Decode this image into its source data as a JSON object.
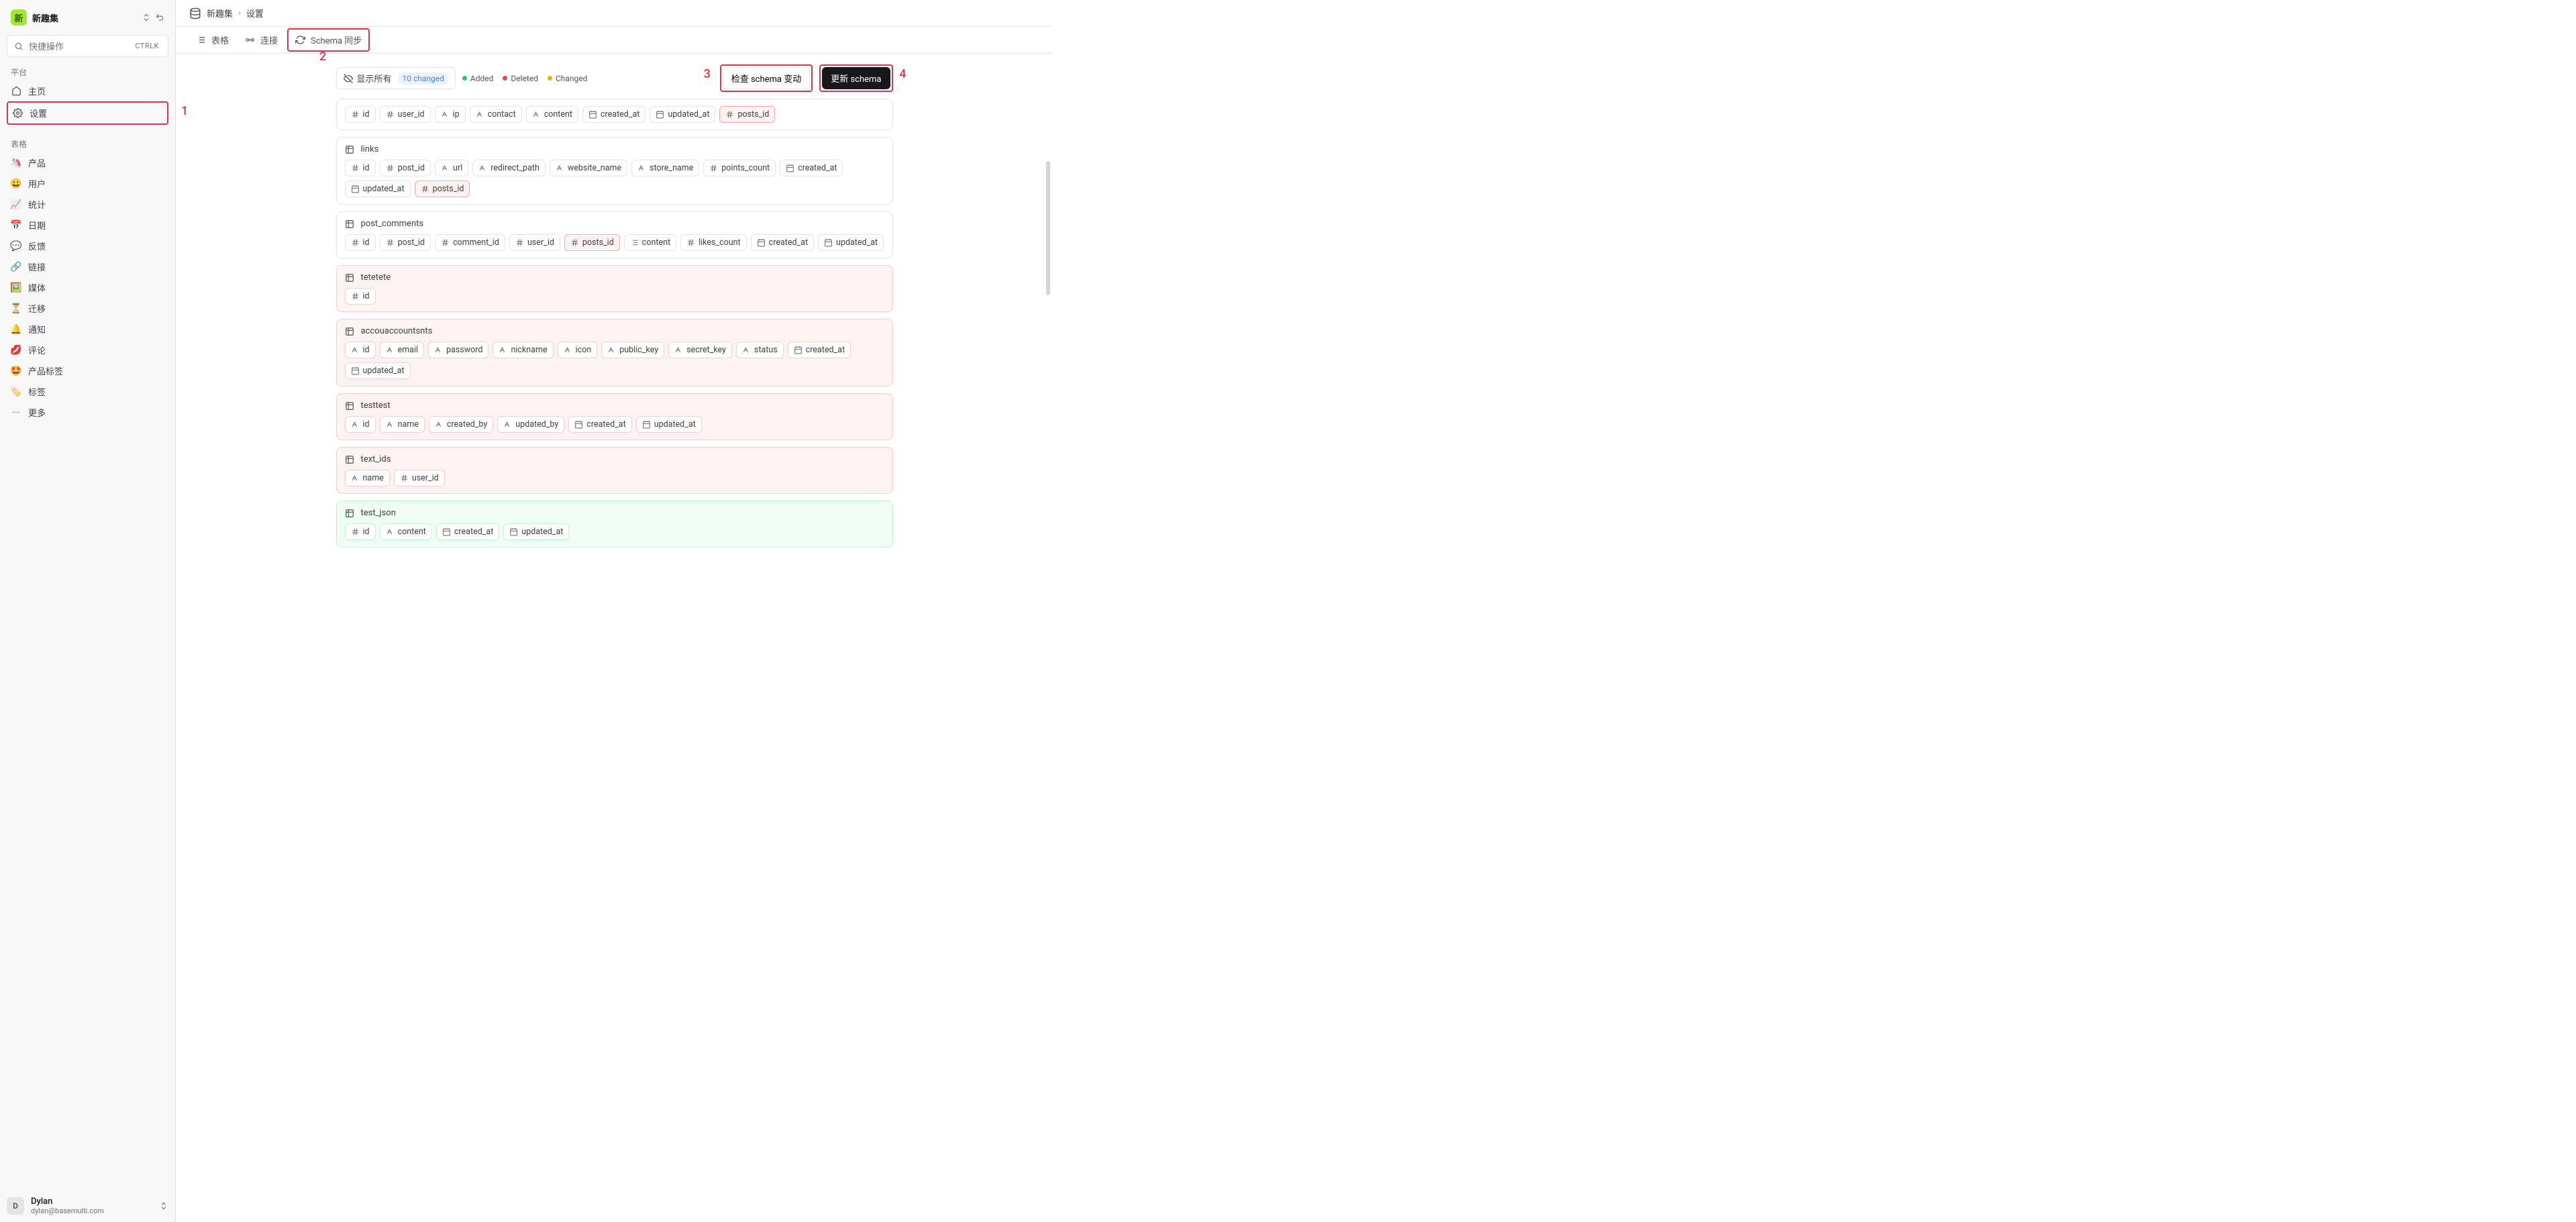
{
  "workspace": {
    "badge": "新",
    "name": "新趣集"
  },
  "quick": {
    "label": "快捷操作",
    "shortcut": "CTRLK"
  },
  "sidebar": {
    "platform_heading": "平台",
    "platform_items": [
      {
        "icon": "home",
        "label": "主页"
      },
      {
        "icon": "gear",
        "label": "设置"
      }
    ],
    "tables_heading": "表格",
    "table_items": [
      {
        "emoji": "🦄",
        "label": "产品"
      },
      {
        "emoji": "😀",
        "label": "用户"
      },
      {
        "emoji": "📈",
        "label": "统计"
      },
      {
        "emoji": "📅",
        "label": "日期"
      },
      {
        "emoji": "💬",
        "label": "反馈"
      },
      {
        "emoji": "🔗",
        "label": "链接"
      },
      {
        "emoji": "🖼️",
        "label": "媒体"
      },
      {
        "emoji": "⏳",
        "label": "迁移"
      },
      {
        "emoji": "🔔",
        "label": "通知"
      },
      {
        "emoji": "💋",
        "label": "评论"
      },
      {
        "emoji": "🤩",
        "label": "产品标签"
      },
      {
        "emoji": "🏷️",
        "label": "标签"
      }
    ],
    "more_label": "更多"
  },
  "user": {
    "initial": "D",
    "name": "Dylan",
    "email": "dylan@basemulti.com"
  },
  "breadcrumb": {
    "root": "新趣集",
    "page": "设置"
  },
  "tabs": [
    {
      "icon": "list",
      "label": "表格"
    },
    {
      "icon": "plug",
      "label": "连接"
    },
    {
      "icon": "refresh",
      "label": "Schema 同步"
    }
  ],
  "toolbar": {
    "show_all": "显示所有",
    "changed_count": "10 changed",
    "legend": {
      "added": "Added",
      "deleted": "Deleted",
      "changed": "Changed"
    },
    "check_btn": "检查 schema 变动",
    "update_btn": "更新 schema"
  },
  "annotations": {
    "a1": "1",
    "a2": "2",
    "a3": "3",
    "a4": "4"
  },
  "tables": [
    {
      "name": "",
      "status": "changed",
      "header_hidden": true,
      "columns": [
        {
          "t": "hash",
          "n": "id"
        },
        {
          "t": "hash",
          "n": "user_id"
        },
        {
          "t": "text",
          "n": "ip"
        },
        {
          "t": "text",
          "n": "contact"
        },
        {
          "t": "text",
          "n": "content"
        },
        {
          "t": "date",
          "n": "created_at"
        },
        {
          "t": "date",
          "n": "updated_at"
        },
        {
          "t": "hash",
          "n": "posts_id",
          "status": "deleted"
        }
      ]
    },
    {
      "name": "links",
      "status": "changed",
      "columns": [
        {
          "t": "hash",
          "n": "id"
        },
        {
          "t": "hash",
          "n": "post_id"
        },
        {
          "t": "text",
          "n": "url"
        },
        {
          "t": "text",
          "n": "redirect_path"
        },
        {
          "t": "text",
          "n": "website_name"
        },
        {
          "t": "text",
          "n": "store_name"
        },
        {
          "t": "hash",
          "n": "points_count"
        },
        {
          "t": "date",
          "n": "created_at"
        },
        {
          "t": "date",
          "n": "updated_at"
        },
        {
          "t": "hash",
          "n": "posts_id",
          "status": "deleted"
        }
      ]
    },
    {
      "name": "post_comments",
      "status": "changed",
      "columns": [
        {
          "t": "hash",
          "n": "id"
        },
        {
          "t": "hash",
          "n": "post_id"
        },
        {
          "t": "hash",
          "n": "comment_id"
        },
        {
          "t": "hash",
          "n": "user_id"
        },
        {
          "t": "hash",
          "n": "posts_id",
          "status": "deleted"
        },
        {
          "t": "list",
          "n": "content"
        },
        {
          "t": "hash",
          "n": "likes_count"
        },
        {
          "t": "date",
          "n": "created_at"
        },
        {
          "t": "date",
          "n": "updated_at"
        }
      ]
    },
    {
      "name": "tetetete",
      "status": "deleted",
      "columns": [
        {
          "t": "hash",
          "n": "id"
        }
      ]
    },
    {
      "name": "accouaccountsnts",
      "status": "deleted",
      "columns": [
        {
          "t": "text",
          "n": "id"
        },
        {
          "t": "text",
          "n": "email"
        },
        {
          "t": "text",
          "n": "password"
        },
        {
          "t": "text",
          "n": "nickname"
        },
        {
          "t": "text",
          "n": "icon"
        },
        {
          "t": "text",
          "n": "public_key"
        },
        {
          "t": "text",
          "n": "secret_key"
        },
        {
          "t": "text",
          "n": "status"
        },
        {
          "t": "date",
          "n": "created_at"
        },
        {
          "t": "date",
          "n": "updated_at"
        }
      ]
    },
    {
      "name": "testtest",
      "status": "deleted",
      "columns": [
        {
          "t": "text",
          "n": "id"
        },
        {
          "t": "text",
          "n": "name"
        },
        {
          "t": "text",
          "n": "created_by"
        },
        {
          "t": "text",
          "n": "updated_by"
        },
        {
          "t": "date",
          "n": "created_at"
        },
        {
          "t": "date",
          "n": "updated_at"
        }
      ]
    },
    {
      "name": "text_ids",
      "status": "deleted",
      "columns": [
        {
          "t": "text",
          "n": "name"
        },
        {
          "t": "hash",
          "n": "user_id"
        }
      ]
    },
    {
      "name": "test_json",
      "status": "added",
      "columns": [
        {
          "t": "hash",
          "n": "id"
        },
        {
          "t": "text",
          "n": "content"
        },
        {
          "t": "date",
          "n": "created_at"
        },
        {
          "t": "date",
          "n": "updated_at"
        }
      ]
    }
  ]
}
